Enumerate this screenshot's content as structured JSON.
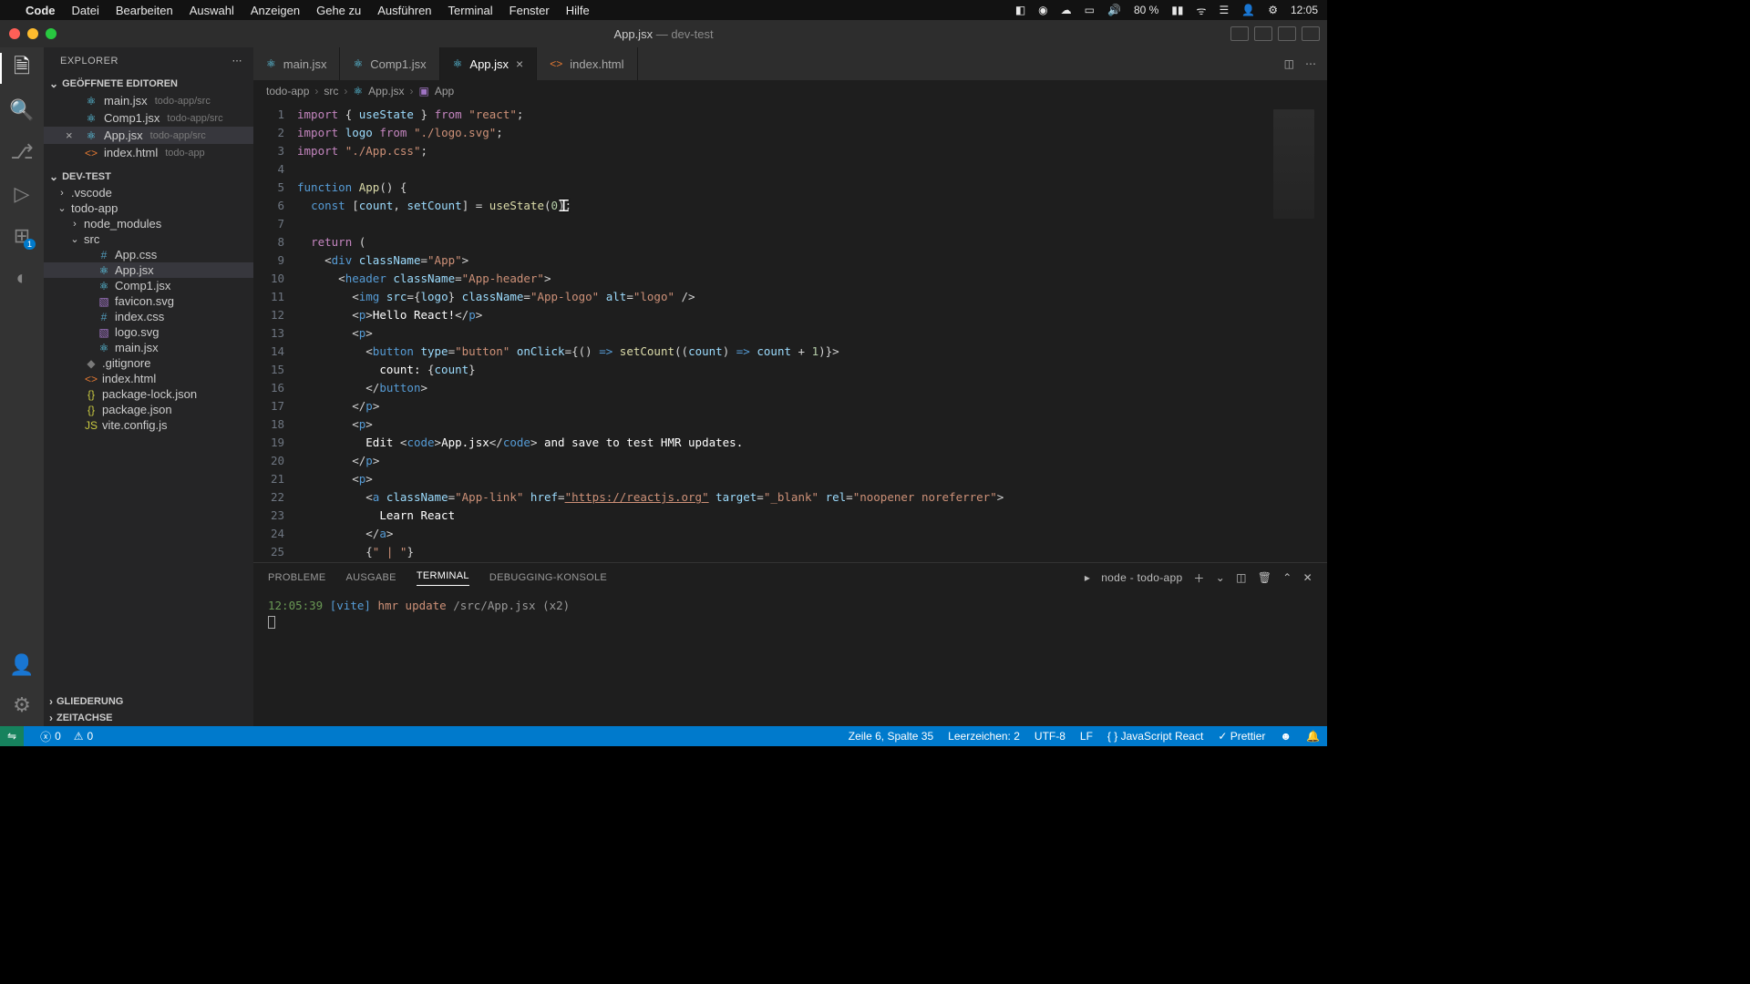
{
  "mac_menu": {
    "apple": "",
    "app": "Code",
    "items": [
      "Datei",
      "Bearbeiten",
      "Auswahl",
      "Anzeigen",
      "Gehe zu",
      "Ausführen",
      "Terminal",
      "Fenster",
      "Hilfe"
    ],
    "right": {
      "battery": "80 %",
      "wifi": "",
      "date": "",
      "clock": "12:05"
    }
  },
  "window": {
    "title_main": "App.jsx",
    "title_sep": " — ",
    "title_sub": "dev-test"
  },
  "explorer": {
    "title": "EXPLORER",
    "open_editors_label": "GEÖFFNETE EDITOREN",
    "open_editors": [
      {
        "name": "main.jsx",
        "path": "todo-app/src",
        "icon": "react",
        "close": ""
      },
      {
        "name": "Comp1.jsx",
        "path": "todo-app/src",
        "icon": "react",
        "close": ""
      },
      {
        "name": "App.jsx",
        "path": "todo-app/src",
        "icon": "react",
        "close": "×",
        "selected": true
      },
      {
        "name": "index.html",
        "path": "todo-app",
        "icon": "html",
        "close": ""
      }
    ],
    "workspace_label": "DEV-TEST",
    "tree": [
      {
        "type": "folder",
        "name": ".vscode",
        "indent": 1,
        "open": false
      },
      {
        "type": "folder",
        "name": "todo-app",
        "indent": 1,
        "open": true
      },
      {
        "type": "folder",
        "name": "node_modules",
        "indent": 2,
        "open": false
      },
      {
        "type": "folder",
        "name": "src",
        "indent": 2,
        "open": true
      },
      {
        "type": "file",
        "name": "App.css",
        "indent": 3,
        "icon": "css"
      },
      {
        "type": "file",
        "name": "App.jsx",
        "indent": 3,
        "icon": "react",
        "selected": true
      },
      {
        "type": "file",
        "name": "Comp1.jsx",
        "indent": 3,
        "icon": "react"
      },
      {
        "type": "file",
        "name": "favicon.svg",
        "indent": 3,
        "icon": "svg"
      },
      {
        "type": "file",
        "name": "index.css",
        "indent": 3,
        "icon": "css"
      },
      {
        "type": "file",
        "name": "logo.svg",
        "indent": 3,
        "icon": "svg"
      },
      {
        "type": "file",
        "name": "main.jsx",
        "indent": 3,
        "icon": "react"
      },
      {
        "type": "file",
        "name": ".gitignore",
        "indent": 2,
        "icon": "git"
      },
      {
        "type": "file",
        "name": "index.html",
        "indent": 2,
        "icon": "html"
      },
      {
        "type": "file",
        "name": "package-lock.json",
        "indent": 2,
        "icon": "json"
      },
      {
        "type": "file",
        "name": "package.json",
        "indent": 2,
        "icon": "json"
      },
      {
        "type": "file",
        "name": "vite.config.js",
        "indent": 2,
        "icon": "js"
      }
    ],
    "outline_label": "GLIEDERUNG",
    "timeline_label": "ZEITACHSE"
  },
  "tabs": [
    {
      "name": "main.jsx",
      "icon": "react"
    },
    {
      "name": "Comp1.jsx",
      "icon": "react"
    },
    {
      "name": "App.jsx",
      "icon": "react",
      "active": true,
      "close": "×"
    },
    {
      "name": "index.html",
      "icon": "html"
    }
  ],
  "breadcrumb": [
    "todo-app",
    "src",
    "App.jsx",
    "App"
  ],
  "code": {
    "lines": [
      1,
      2,
      3,
      4,
      5,
      6,
      7,
      8,
      9,
      10,
      11,
      12,
      13,
      14,
      15,
      16,
      17,
      18,
      19,
      20,
      21,
      22,
      23,
      24,
      25
    ],
    "content": {
      "useState": "useState",
      "from": "from",
      "react": "\"react\"",
      "logo": "logo",
      "logosrc": "\"./logo.svg\"",
      "appcss": "\"./App.css\"",
      "function": "function",
      "App": "App",
      "const": "const",
      "count": "count",
      "setCount": "setCount",
      "zero": "0",
      "return": "return",
      "div": "div",
      "className": "className",
      "Appstr": "\"App\"",
      "header": "header",
      "Appheader": "\"App-header\"",
      "img": "img",
      "src": "src",
      "Applogo": "\"App-logo\"",
      "alt": "alt",
      "logostr": "\"logo\"",
      "p": "p",
      "hello": "Hello React!",
      "button": "button",
      "type": "type",
      "buttonstr": "\"button\"",
      "onClick": "onClick",
      "countlabel": "count: ",
      "edit": "Edit ",
      "code": "code",
      "appjsx": "App.jsx",
      "save": " and save to test HMR updates.",
      "a": "a",
      "Applink": "\"App-link\"",
      "href": "href",
      "reacturl": "\"https://reactjs.org\"",
      "target": "target",
      "blank": "\"_blank\"",
      "rel": "rel",
      "noop": "\"noopener noreferrer\"",
      "learn": "Learn React",
      "pipe": "\" | \"",
      "one": "1"
    }
  },
  "panel": {
    "tabs": [
      "PROBLEME",
      "AUSGABE",
      "TERMINAL",
      "DEBUGGING-KONSOLE"
    ],
    "active": "TERMINAL",
    "term_label": "node - todo-app",
    "terminal": {
      "time": "12:05:39",
      "vite": "[vite]",
      "hmr": "hmr update",
      "path": "/src/App.jsx",
      "count": "(x2)"
    }
  },
  "status": {
    "remote": "⇋",
    "errors": "0",
    "warnings": "0",
    "cursor": "Zeile 6, Spalte 35",
    "spaces": "Leerzeichen: 2",
    "encoding": "UTF-8",
    "eol": "LF",
    "lang": "JavaScript React",
    "prettier": "Prettier",
    "check": "✓"
  },
  "activity_badge": "1"
}
